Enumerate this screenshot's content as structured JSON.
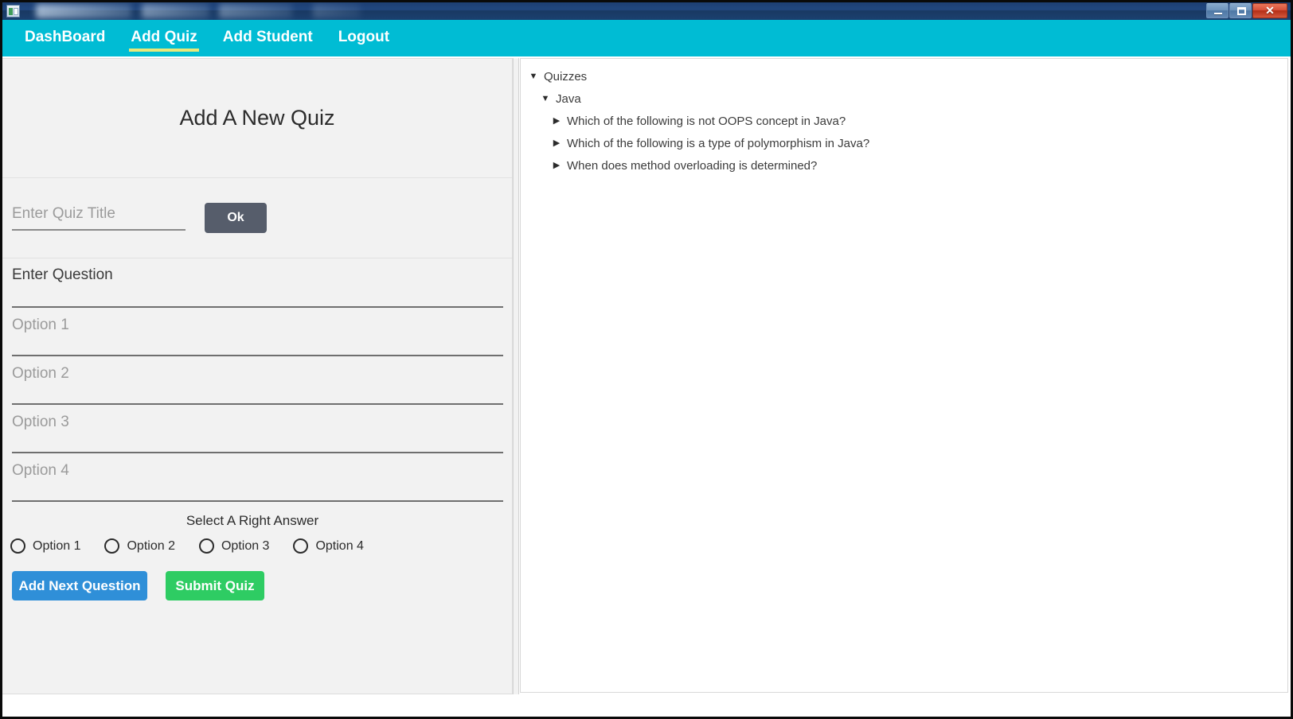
{
  "window": {
    "title": "",
    "controls": {
      "minimize": "minimize",
      "maximize": "restore",
      "close": "✕"
    }
  },
  "navbar": {
    "items": [
      {
        "label": "DashBoard",
        "active": false
      },
      {
        "label": "Add Quiz",
        "active": true
      },
      {
        "label": "Add Student",
        "active": false
      },
      {
        "label": "Logout",
        "active": false
      }
    ],
    "background_color": "#00bcd4",
    "active_underline_color": "#e8e87a"
  },
  "form": {
    "heading": "Add A New Quiz",
    "quiz_title": {
      "placeholder": "Enter Quiz Title",
      "value": ""
    },
    "ok_button": {
      "label": "Ok",
      "color": "#565d6b"
    },
    "question": {
      "placeholder": "Enter Question",
      "value": ""
    },
    "options": [
      {
        "placeholder": "Option 1",
        "value": ""
      },
      {
        "placeholder": "Option 2",
        "value": ""
      },
      {
        "placeholder": "Option 3",
        "value": ""
      },
      {
        "placeholder": "Option 4",
        "value": ""
      }
    ],
    "answer_label": "Select A Right Answer",
    "answer_choices": [
      {
        "label": "Option 1",
        "selected": false
      },
      {
        "label": "Option 2",
        "selected": false
      },
      {
        "label": "Option 3",
        "selected": false
      },
      {
        "label": "Option 4",
        "selected": false
      }
    ],
    "actions": {
      "add_next": {
        "label": "Add Next Question",
        "color": "#2f8fd8"
      },
      "submit": {
        "label": "Submit Quiz",
        "color": "#2ecc63"
      }
    }
  },
  "tree": {
    "root": {
      "label": "Quizzes",
      "twisty": "▼"
    },
    "category": {
      "label": "Java",
      "twisty": "▼"
    },
    "questions": [
      {
        "label": "Which of the following is not OOPS concept in Java?",
        "twisty": "▶"
      },
      {
        "label": "Which of the following is a type of polymorphism in Java?",
        "twisty": "▶"
      },
      {
        "label": "When does method overloading is determined?",
        "twisty": "▶"
      }
    ]
  }
}
